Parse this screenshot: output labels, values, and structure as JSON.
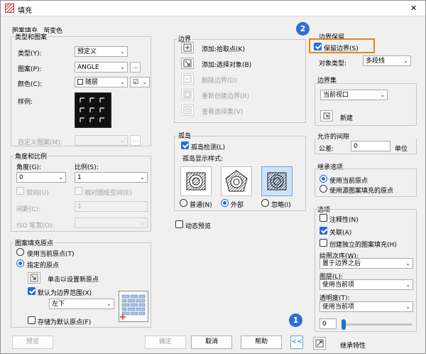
{
  "window": {
    "title": "填充",
    "close": "✕"
  },
  "tabs": {
    "pattern": "图案填充",
    "gradient": "渐变色"
  },
  "type_pattern": {
    "group": "类型和图案",
    "type_label": "类型(Y):",
    "type_value": "预定义",
    "pattern_label": "图案(P):",
    "pattern_value": "ANGLE",
    "browse": "...",
    "color_label": "颜色(C):",
    "color_value": "随层",
    "bgcolor_value": "☑",
    "sample_label": "样例:",
    "custom_label": "自定义图案(M):",
    "custom_browse": "..."
  },
  "angle_scale": {
    "group": "角度和比例",
    "angle_label": "角度(G):",
    "angle_value": "0",
    "scale_label": "比例(S):",
    "scale_value": "1",
    "double_label": "双向(U)",
    "relative_label": "相对图纸空间(E)",
    "spacing_label": "间距(C):",
    "spacing_value": "1",
    "iso_label": "ISO 笔宽(O):"
  },
  "origin": {
    "group": "图案填充原点",
    "use_current": "使用当前原点(T)",
    "specified": "指定的原点",
    "click_set": "单击以设置新原点",
    "default_extents": "默认为边界范围(X)",
    "position_value": "左下",
    "store_default": "存储为默认原点(F)"
  },
  "boundary": {
    "group": "边界",
    "add_pick": "添加:拾取点(K)",
    "add_select": "添加:选择对象(B)",
    "remove": "删除边界(D)",
    "recreate": "重新创建边界(R)",
    "view_sel": "查看选择集(V)"
  },
  "islands": {
    "group": "孤岛",
    "detect_label": "孤岛检测(L)",
    "style_label": "孤岛显示样式:",
    "normal": "普通(N)",
    "outer": "外部",
    "ignore": "忽略(I)"
  },
  "dynamic_preview": "动态预览",
  "retention": {
    "group": "边界保留",
    "retain_label": "保留边界(S)",
    "obj_type_label": "对象类型:",
    "obj_type_value": "多段线"
  },
  "boundary_set": {
    "group": "边界集",
    "value": "当前视口",
    "new_label": "新建"
  },
  "gap": {
    "group": "允许的间隙",
    "tol_label": "公差:",
    "tol_value": "0",
    "unit": "单位"
  },
  "inherit": {
    "group": "继承选项",
    "use_current": "使用当前原点",
    "use_source": "使用源图案填充的原点"
  },
  "options": {
    "group": "选项",
    "annotative": "注释性(N)",
    "associative": "关联(A)",
    "separate": "创建独立的图案填充(H)",
    "draw_order_label": "绘图次序(W):",
    "draw_order_value": "置于边界之后",
    "layer_label": "图层(L):",
    "layer_value": "使用当前项",
    "transparency_label": "透明度(T):",
    "transparency_value": "使用当前项",
    "slider_value": "0"
  },
  "inherit_props": "继承特性",
  "buttons": {
    "preview": "预览",
    "ok": "确定",
    "cancel": "取消",
    "help": "帮助",
    "collapse": "<<"
  },
  "badges": {
    "one": "1",
    "two": "2"
  },
  "accent": {
    "blue": "#1e6fd9",
    "highlight": "#e8841a"
  }
}
